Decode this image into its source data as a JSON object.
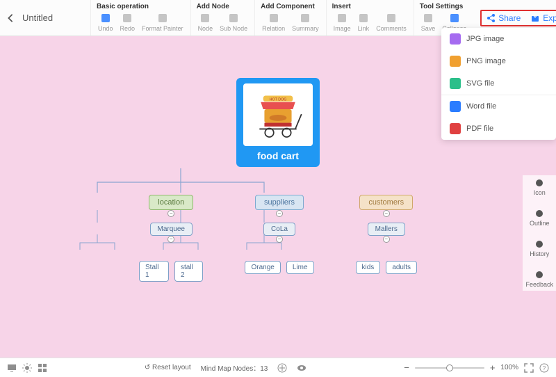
{
  "document": {
    "title": "Untitled"
  },
  "toolbar": {
    "groups": [
      {
        "label": "Basic operation",
        "items": [
          "Undo",
          "Redo",
          "Format Painter"
        ]
      },
      {
        "label": "Add Node",
        "items": [
          "Node",
          "Sub Node"
        ]
      },
      {
        "label": "Add Component",
        "items": [
          "Relation",
          "Summary"
        ]
      },
      {
        "label": "Insert",
        "items": [
          "Image",
          "Link",
          "Comments"
        ]
      },
      {
        "label": "Tool Settings",
        "items": [
          "Save",
          "Collapse"
        ]
      }
    ],
    "share": "Share",
    "export": "Export"
  },
  "export_menu": [
    {
      "label": "JPG image",
      "icon": "#a56bf0"
    },
    {
      "label": "PNG image",
      "icon": "#f0a030"
    },
    {
      "label": "SVG file",
      "icon": "#2bbf8a"
    },
    {
      "divider": true
    },
    {
      "label": "Word file",
      "icon": "#2a7cff"
    },
    {
      "label": "PDF file",
      "icon": "#e04040"
    }
  ],
  "right_rail": [
    "Icon",
    "Outline",
    "History",
    "Feedback"
  ],
  "mindmap": {
    "root": {
      "label": "food cart",
      "image_alt": "hot-dog-cart"
    },
    "branches": [
      {
        "label": "location",
        "tone": "loc",
        "sub": "Marquee",
        "leaves": [
          "Stall 1",
          "stall 2"
        ]
      },
      {
        "label": "suppliers",
        "tone": "sup",
        "sub": "CoLa",
        "leaves": [
          "Orange",
          "Lime"
        ]
      },
      {
        "label": "customers",
        "tone": "cus",
        "sub": "Mallers",
        "leaves": [
          "kids",
          "adults"
        ]
      }
    ]
  },
  "statusbar": {
    "reset": "Reset layout",
    "nodes_label": "Mind Map Nodes：",
    "nodes_count": "13",
    "zoom_minus": "−",
    "zoom_plus": "+",
    "zoom_pct": "100%"
  },
  "toolbar_icon_colors": {
    "Undo": "#2a7cff",
    "Redo": "#bbb",
    "Format Painter": "#bbb",
    "Node": "#bbb",
    "Sub Node": "#bbb",
    "Relation": "#bbb",
    "Summary": "#bbb",
    "Image": "#bbb",
    "Link": "#bbb",
    "Comments": "#bbb",
    "Save": "#bbb",
    "Collapse": "#2a7cff"
  }
}
